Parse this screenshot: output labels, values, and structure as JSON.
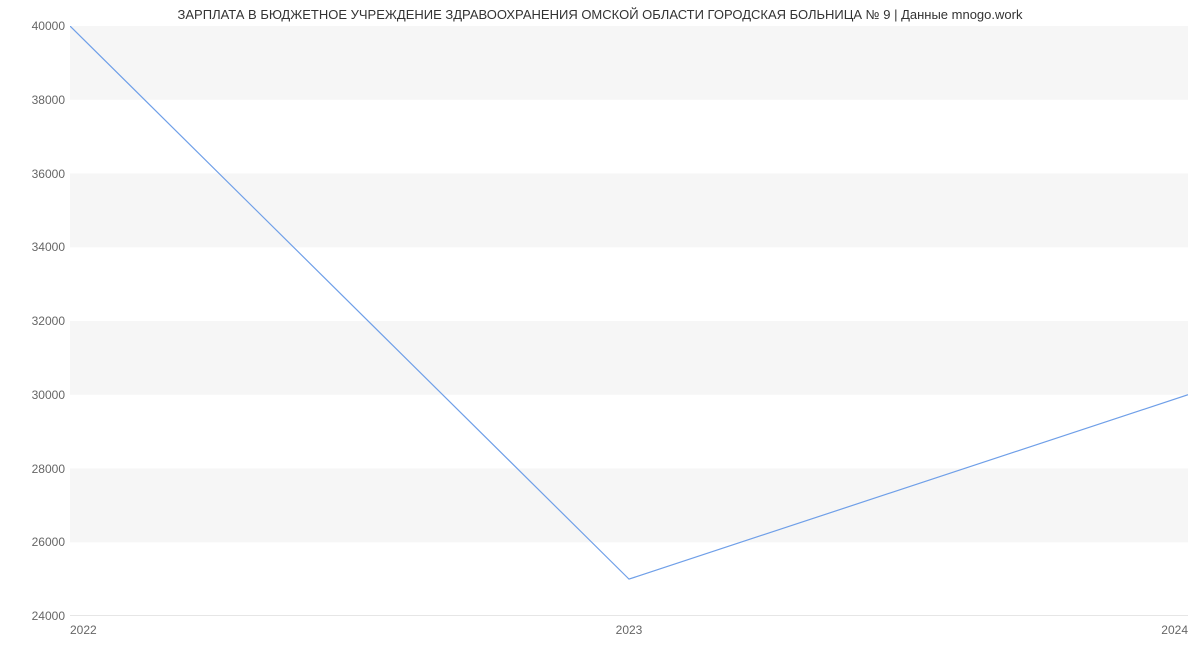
{
  "chart_data": {
    "type": "line",
    "title": "ЗАРПЛАТА В БЮДЖЕТНОЕ УЧРЕЖДЕНИЕ ЗДРАВООХРАНЕНИЯ ОМСКОЙ ОБЛАСТИ ГОРОДСКАЯ БОЛЬНИЦА № 9 | Данные mnogo.work",
    "x": [
      2022,
      2023,
      2024
    ],
    "values": [
      40000,
      25000,
      30000
    ],
    "x_ticks": [
      "2022",
      "2023",
      "2024"
    ],
    "y_ticks": [
      "24000",
      "26000",
      "28000",
      "30000",
      "32000",
      "34000",
      "36000",
      "38000",
      "40000"
    ],
    "xlim": [
      2022,
      2024
    ],
    "ylim": [
      24000,
      40000
    ],
    "line_color": "#6f9fe8",
    "grid_band_color": "#f6f6f6"
  }
}
